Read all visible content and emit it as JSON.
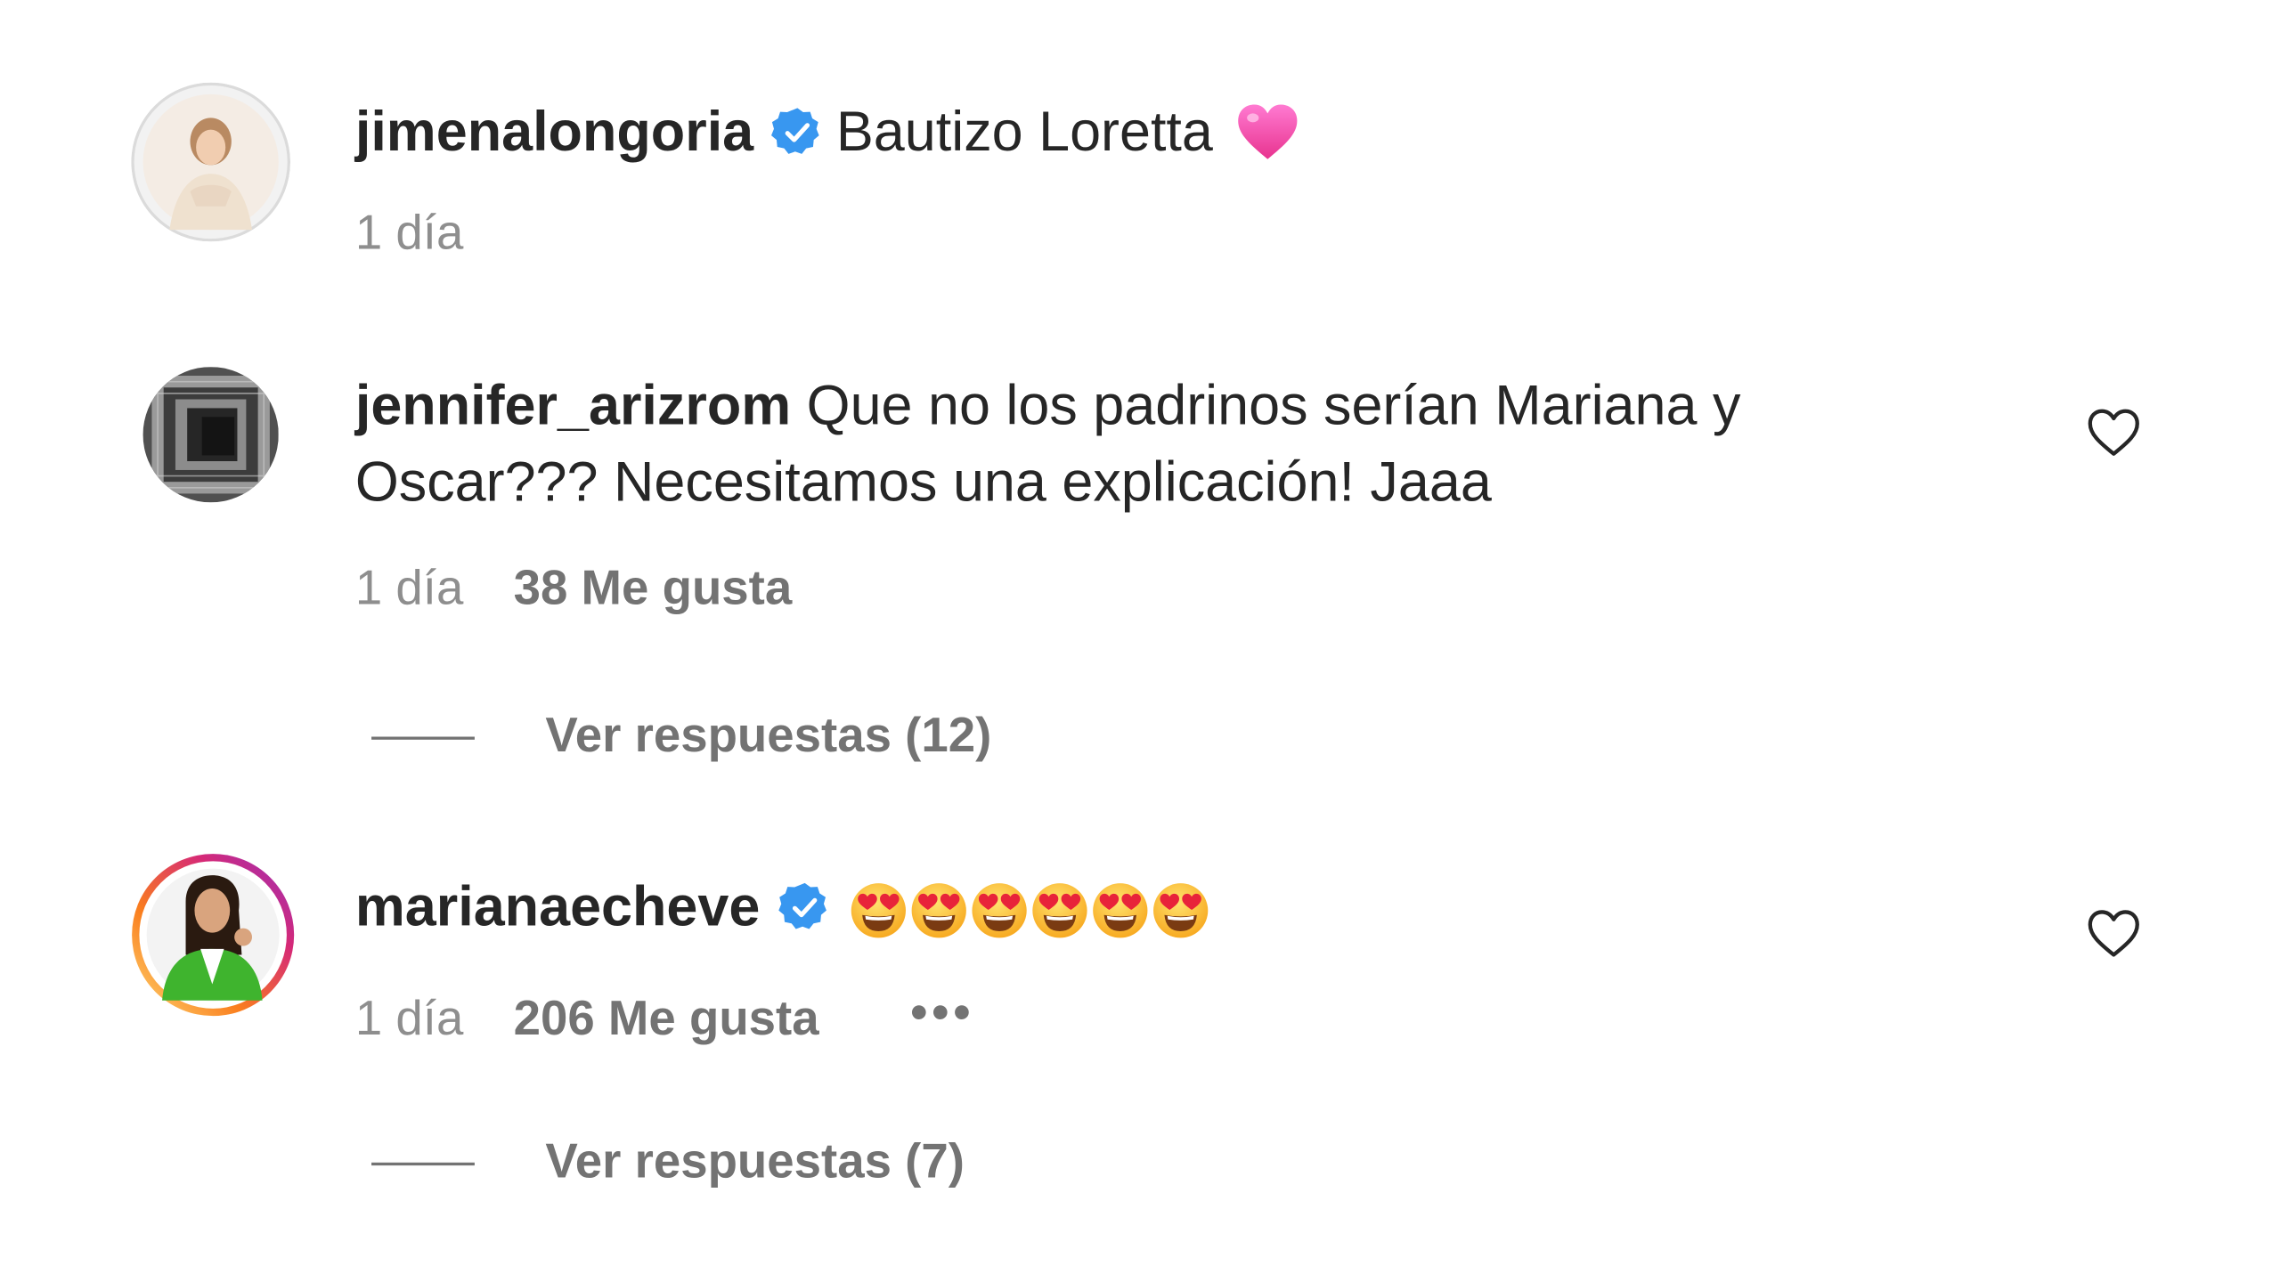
{
  "comments": [
    {
      "username": "jimenalongoria",
      "verified": true,
      "text": "Bautizo Loretta",
      "emoji": "pink-heart",
      "time": "1 día",
      "likes": "",
      "replies": ""
    },
    {
      "username": "jennifer_arizrom",
      "verified": false,
      "text_line1": "Que no los padrinos serían Mariana y",
      "text_line2": "Oscar??? Necesitamos una explicación! Jaaa",
      "time": "1 día",
      "likes": "38 Me gusta",
      "replies": "Ver respuestas (12)"
    },
    {
      "username": "marianaecheve",
      "verified": true,
      "emoji": "heart-eyes-face",
      "emoji_count": 6,
      "time": "1 día",
      "likes": "206 Me gusta",
      "more": "•••",
      "replies": "Ver respuestas (7)"
    }
  ],
  "colors": {
    "verified_blue": "#3897f0",
    "text": "#262626",
    "secondary": "#737373",
    "story_ring_start": "#feda75",
    "story_ring_end": "#d62976"
  }
}
